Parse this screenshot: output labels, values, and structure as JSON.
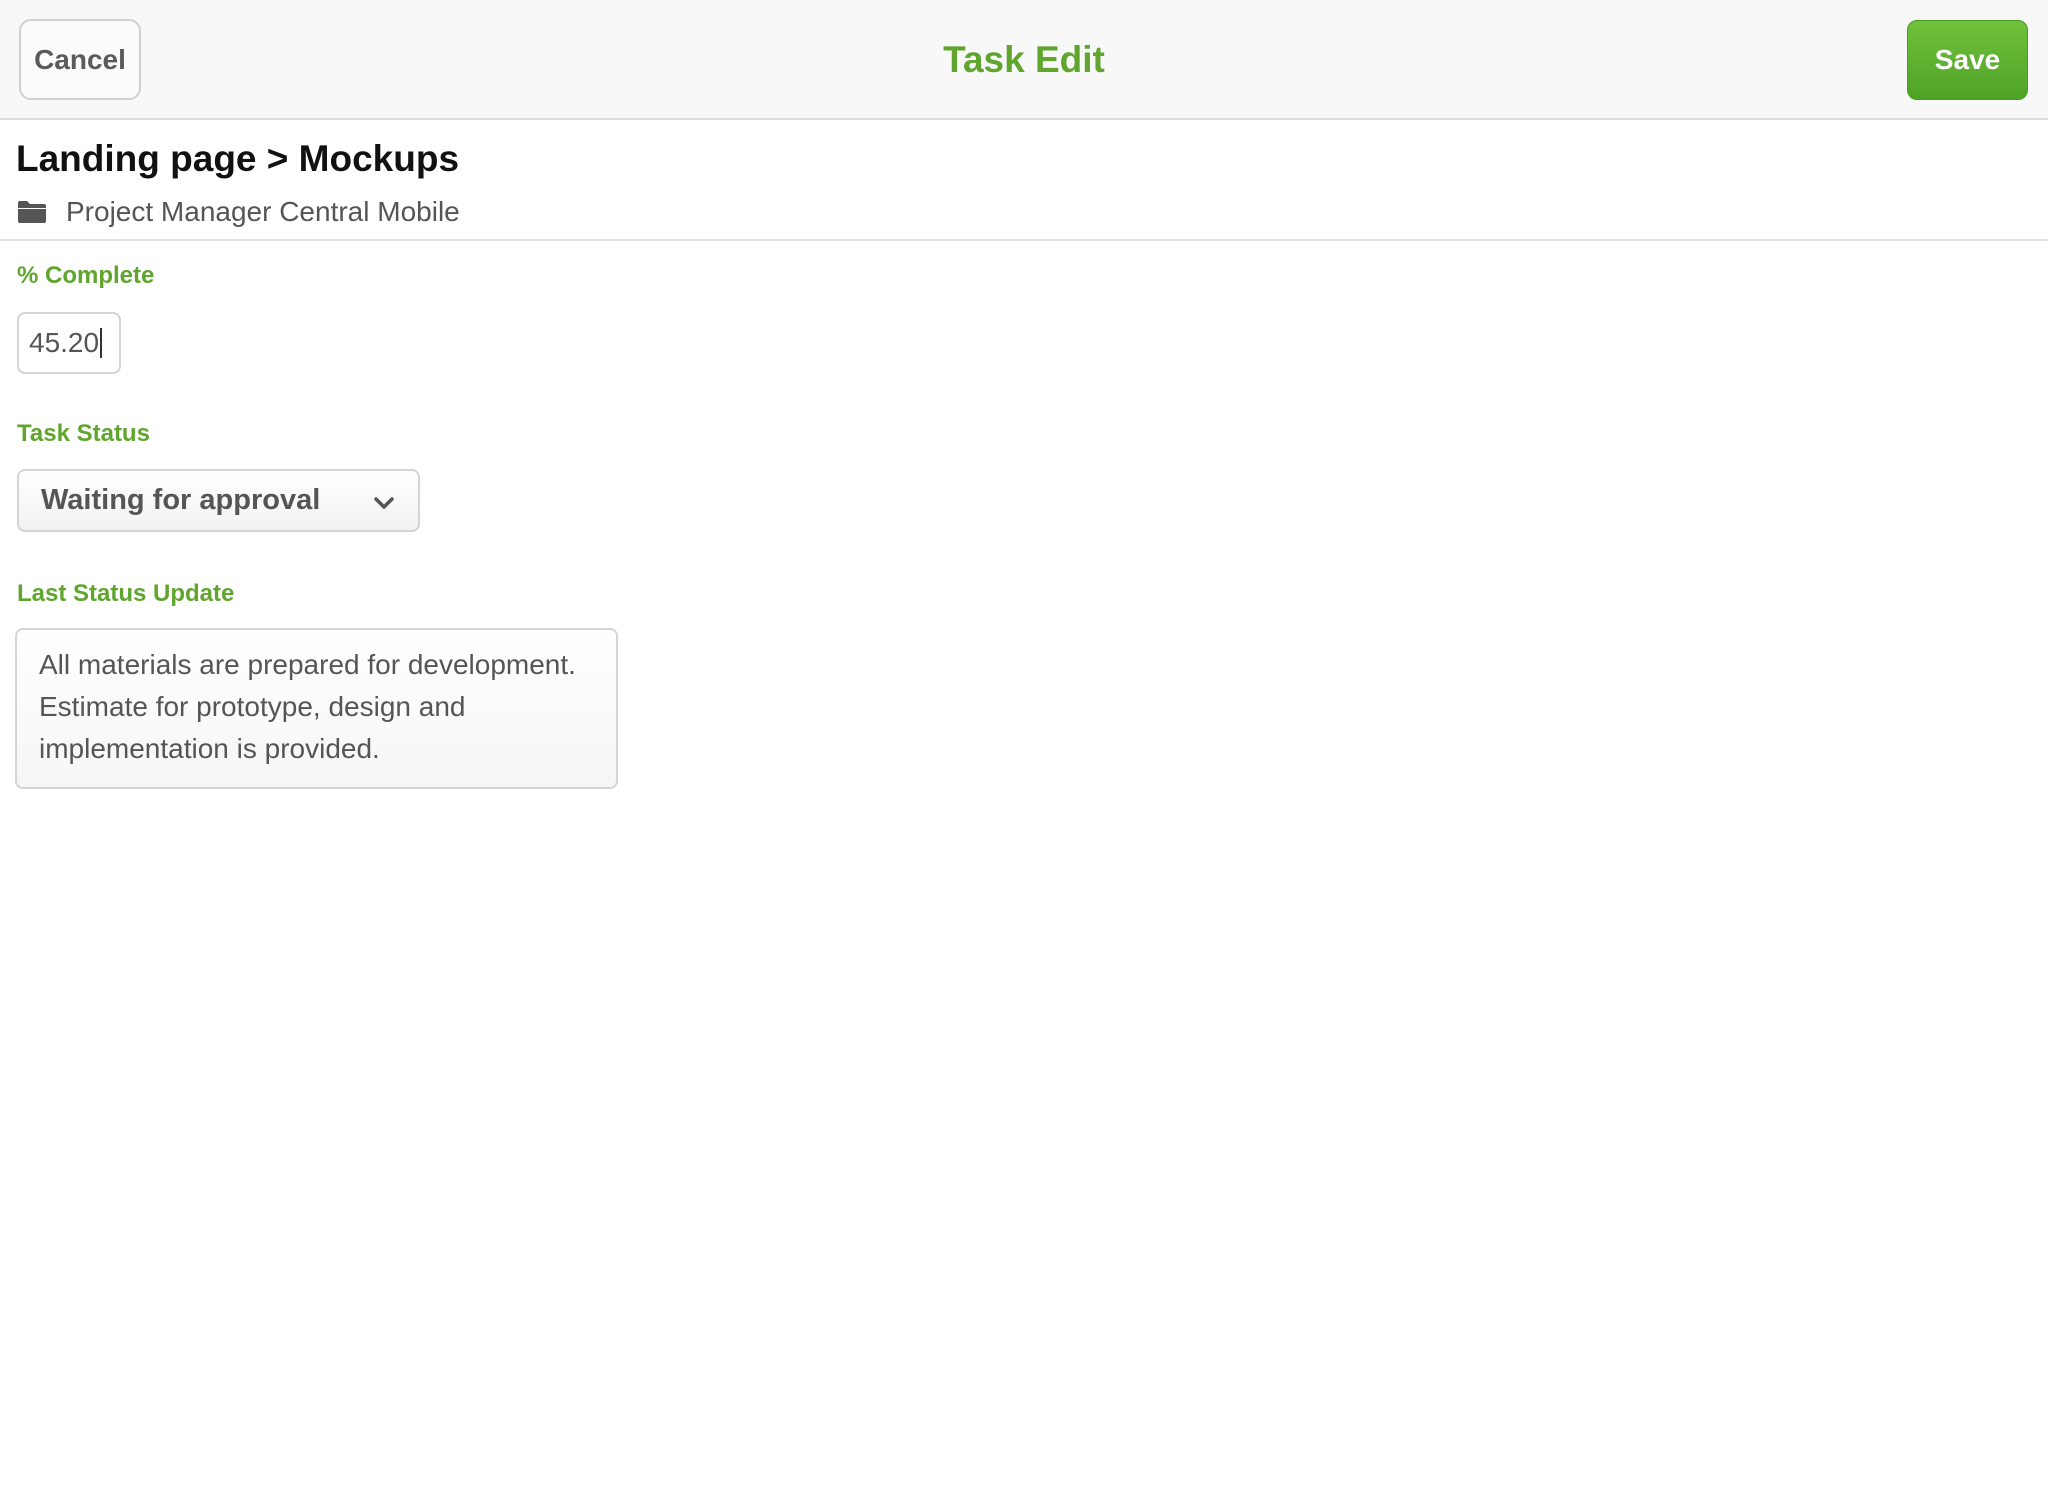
{
  "navbar": {
    "title": "Task Edit",
    "cancel_label": "Cancel",
    "save_label": "Save"
  },
  "task": {
    "breadcrumb": "Landing page > Mockups",
    "project_icon": "folder-icon",
    "project_name": "Project Manager Central Mobile"
  },
  "form": {
    "percent_complete": {
      "label": "% Complete",
      "value": "45.20"
    },
    "task_status": {
      "label": "Task Status",
      "selected": "Waiting for approval"
    },
    "last_status_update": {
      "label": "Last Status Update",
      "value": "All materials are prepared for development.\nEstimate for prototype, design and\nimplementation is provided."
    }
  },
  "colors": {
    "accent": "#5fa52e",
    "save_button": "#5cb22f",
    "text": "#555555"
  }
}
